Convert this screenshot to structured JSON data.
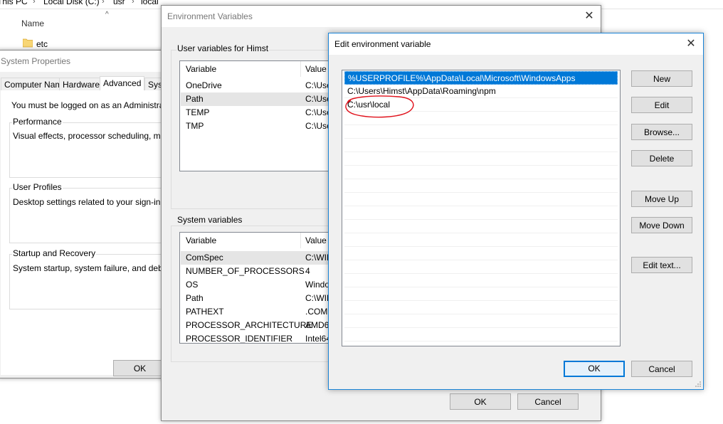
{
  "explorer": {
    "breadcrumb": [
      "This PC",
      "Local Disk (C:)",
      "usr",
      "local"
    ],
    "column_header": "Name",
    "items": [
      {
        "label": "etc"
      }
    ]
  },
  "system_properties": {
    "title": "System Properties",
    "tabs": [
      "Computer Name",
      "Hardware",
      "Advanced",
      "Sys"
    ],
    "active_tab": "Advanced",
    "notice": "You must be logged on as an Administrator to",
    "groups": [
      {
        "label": "Performance",
        "description": "Visual effects, processor scheduling, memor"
      },
      {
        "label": "User Profiles",
        "description": "Desktop settings related to your sign-in"
      },
      {
        "label": "Startup and Recovery",
        "description": "System startup, system failure, and debuggir"
      }
    ],
    "ok_label": "OK"
  },
  "environment_variables": {
    "title": "Environment Variables",
    "user_section_label": "User variables for Himst",
    "system_section_label": "System variables",
    "columns": [
      "Variable",
      "Value"
    ],
    "user_rows": [
      {
        "name": "OneDrive",
        "value": "C:\\Use"
      },
      {
        "name": "Path",
        "value": "C:\\Use",
        "selected": true
      },
      {
        "name": "TEMP",
        "value": "C:\\Use"
      },
      {
        "name": "TMP",
        "value": "C:\\Use"
      }
    ],
    "system_rows": [
      {
        "name": "ComSpec",
        "value": "C:\\WIN",
        "selected": true
      },
      {
        "name": "NUMBER_OF_PROCESSORS",
        "value": "4"
      },
      {
        "name": "OS",
        "value": "Windo"
      },
      {
        "name": "Path",
        "value": "C:\\WIN"
      },
      {
        "name": "PATHEXT",
        "value": ".COM;"
      },
      {
        "name": "PROCESSOR_ARCHITECTURE",
        "value": "AMD6"
      },
      {
        "name": "PROCESSOR_IDENTIFIER",
        "value": "Intel64"
      }
    ],
    "ok_label": "OK",
    "cancel_label": "Cancel"
  },
  "edit_dialog": {
    "title": "Edit environment variable",
    "paths": [
      "%USERPROFILE%\\AppData\\Local\\Microsoft\\WindowsApps",
      "C:\\Users\\Himst\\AppData\\Roaming\\npm",
      "C:\\usr\\local"
    ],
    "selected_index": 0,
    "annotated_index": 2,
    "annotation_color": "#e0101a",
    "selection_color": "#0078d7",
    "buttons": {
      "new": "New",
      "edit": "Edit",
      "browse": "Browse...",
      "delete": "Delete",
      "move_up": "Move Up",
      "move_down": "Move Down",
      "edit_text": "Edit text..."
    },
    "ok_label": "OK",
    "cancel_label": "Cancel"
  }
}
